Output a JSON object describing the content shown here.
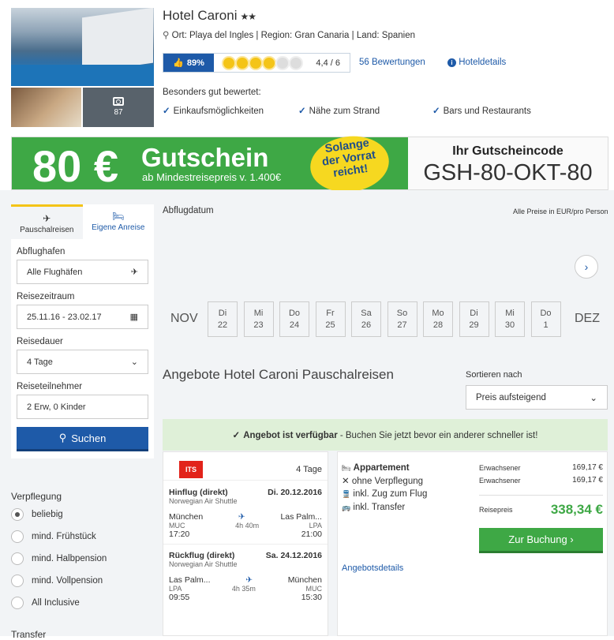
{
  "hotel": {
    "name": "Hotel Caroni",
    "stars": "★★",
    "location": "Ort: Playa del Ingles | Region: Gran Canaria | Land: Spanien",
    "photo_count": "87",
    "recommend": "89%",
    "sun_rating": 4,
    "sun_max": 6,
    "score": "4,4 / 6",
    "reviews_link": "56 Bewertungen",
    "details_link": "Hoteldetails",
    "best_title": "Besonders gut bewertet:",
    "best_items": [
      "Einkaufsmöglichkeiten",
      "Nähe zum Strand",
      "Bars und Restaurants"
    ]
  },
  "banner": {
    "amount": "80 €",
    "word": "Gutschein",
    "min": "ab Mindestreisepreis v. 1.400€",
    "stamp_1": "Solange",
    "stamp_2": "der Vorrat",
    "stamp_3": "reicht!",
    "code_label": "Ihr Gutscheincode",
    "code": "GSH-80-OKT-80"
  },
  "sidebar": {
    "tab_package": "Pauschalreisen",
    "tab_own": "Eigene Anreise",
    "airport_label": "Abflughafen",
    "airport_value": "Alle Flughäfen",
    "period_label": "Reisezeitraum",
    "period_value": "25.11.16 - 23.02.17",
    "duration_label": "Reisedauer",
    "duration_value": "4 Tage",
    "travellers_label": "Reiseteilnehmer",
    "travellers_value": "2 Erw, 0 Kinder",
    "search_label": "Suchen",
    "board_title": "Verpflegung",
    "board_options": [
      "beliebig",
      "mind. Frühstück",
      "mind. Halbpension",
      "mind. Vollpension",
      "All Inclusive"
    ],
    "board_selected": 0,
    "transfer_title": "Transfer"
  },
  "dates": {
    "title": "Abflugdatum",
    "prices_note": "Alle Preise in EUR/pro Person",
    "month_prev": "NOV",
    "month_next": "DEZ",
    "days": [
      {
        "dow": "Di",
        "day": "22"
      },
      {
        "dow": "Mi",
        "day": "23"
      },
      {
        "dow": "Do",
        "day": "24"
      },
      {
        "dow": "Fr",
        "day": "25"
      },
      {
        "dow": "Sa",
        "day": "26"
      },
      {
        "dow": "So",
        "day": "27"
      },
      {
        "dow": "Mo",
        "day": "28"
      },
      {
        "dow": "Di",
        "day": "29"
      },
      {
        "dow": "Mi",
        "day": "30"
      },
      {
        "dow": "Do",
        "day": "1"
      }
    ]
  },
  "offers": {
    "title": "Angebote Hotel Caroni Pauschalreisen",
    "sort_label": "Sortieren nach",
    "sort_value": "Preis aufsteigend",
    "avail_bold": "Angebot ist verfügbar",
    "avail_text": " - Buchen Sie jetzt bevor ein anderer schneller ist!"
  },
  "offer": {
    "operator": "ITS",
    "duration": "4 Tage",
    "out_label": "Hinflug (direkt)",
    "out_date": "Di. 20.12.2016",
    "out_airline": "Norwegian Air Shuttle",
    "out_from": "München",
    "out_from_code": "MUC",
    "out_dep": "17:20",
    "out_dur": "4h 40m",
    "out_to": "Las Palm...",
    "out_to_code": "LPA",
    "out_arr": "21:00",
    "ret_label": "Rückflug (direkt)",
    "ret_date": "Sa. 24.12.2016",
    "ret_airline": "Norwegian Air Shuttle",
    "ret_from": "Las Palm...",
    "ret_from_code": "LPA",
    "ret_dep": "09:55",
    "ret_dur": "4h 35m",
    "ret_to": "München",
    "ret_to_code": "MUC",
    "ret_arr": "15:30",
    "room": "Appartement",
    "board": "ohne Verpflegung",
    "train": "inkl. Zug zum Flug",
    "transfer": "inkl. Transfer",
    "details_link": "Angebotsdetails",
    "adult_label": "Erwachsener",
    "adult1_price": "169,17 €",
    "adult2_price": "169,17 €",
    "total_label": "Reisepreis",
    "total_price": "338,34 €",
    "book_label": "Zur Buchung"
  }
}
